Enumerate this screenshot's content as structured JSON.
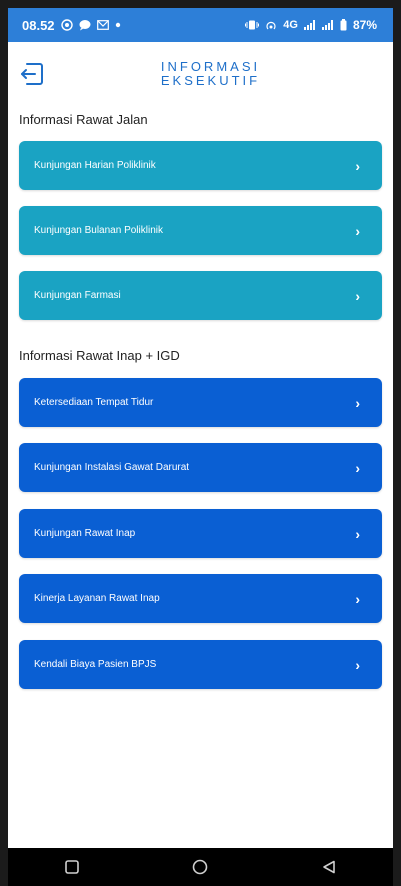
{
  "status_bar": {
    "time": "08.52",
    "network": "4G",
    "battery": "87%"
  },
  "header": {
    "title_line1": "INFORMASI",
    "title_line2": "EKSEKUTIF"
  },
  "sections": {
    "rawat_jalan": {
      "label": "Informasi Rawat Jalan",
      "items": [
        {
          "label": "Kunjungan Harian Poliklinik"
        },
        {
          "label": "Kunjungan Bulanan Poliklinik"
        },
        {
          "label": "Kunjungan Farmasi"
        }
      ]
    },
    "rawat_inap": {
      "label": "Informasi Rawat Inap + IGD",
      "items": [
        {
          "label": "Ketersediaan Tempat Tidur"
        },
        {
          "label": "Kunjungan Instalasi Gawat Darurat"
        },
        {
          "label": "Kunjungan Rawat Inap"
        },
        {
          "label": "Kinerja Layanan Rawat Inap"
        },
        {
          "label": "Kendali Biaya Pasien BPJS"
        }
      ]
    }
  },
  "colors": {
    "status_bar": "#2d7fd8",
    "teal_button": "#1aa3c3",
    "blue_button": "#0a5fd3",
    "title": "#1e6fc9"
  },
  "icons": {
    "back": "logout-arrow-icon",
    "chevron": "chevron-right-icon",
    "nav_recent": "square-icon",
    "nav_home": "circle-icon",
    "nav_back": "triangle-back-icon"
  }
}
